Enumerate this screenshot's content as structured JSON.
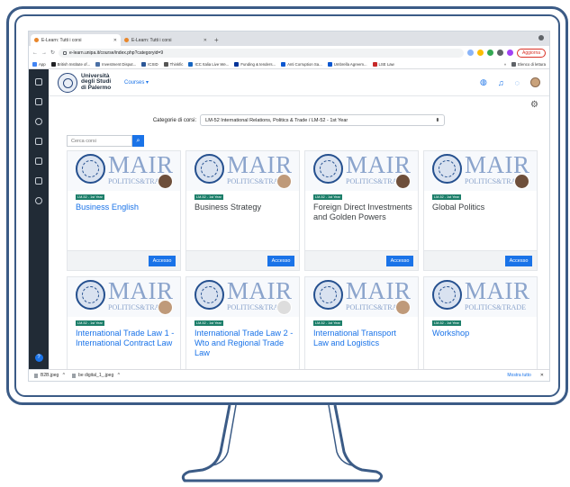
{
  "browser": {
    "tabs": [
      {
        "title": "E-Learn: Tutti i corsi",
        "active": true
      },
      {
        "title": "E-Learn: Tutti i corsi",
        "active": false
      }
    ],
    "url": "e-learn.unipa.it/course/index.php?categoryid=9",
    "update_label": "Aggiorna",
    "bookmarks": [
      "App",
      "British Institute of...",
      "Investment Disput...",
      "ICSID",
      "Thinkfic",
      "ICC Italia Live We...",
      "Funding & tenders...",
      "Anti Corruption Sa...",
      "Umbrella Agreem...",
      "LSE Law"
    ],
    "reading_list": "Elenco di lettura"
  },
  "site": {
    "logo_text": "Università degli Studi di Palermo",
    "courses_menu": "Courses"
  },
  "filter": {
    "category_label": "Categorie di corsi:",
    "category_value": "LM-52 International Relations, Politics & Trade / LM-52 - 1st Year",
    "search_placeholder": "Cerca corsi"
  },
  "course_image": {
    "brand": "MAIR",
    "subtitle": "POLITICS&TRADE",
    "subtitle_short": "POLITICS&TRA"
  },
  "courses": [
    {
      "badge": "LM-52 - 1st Year",
      "title": "Business English",
      "button": "Accesso"
    },
    {
      "badge": "LM-52 - 1st Year",
      "title": "Business Strategy",
      "button": "Accesso"
    },
    {
      "badge": "LM-52 - 1st Year",
      "title": "Foreign Direct Investments and Golden Powers",
      "button": "Accesso"
    },
    {
      "badge": "LM-52 - 1st Year",
      "title": "Global Politics",
      "button": "Accesso"
    },
    {
      "badge": "LM-52 - 1st Year",
      "title": "International Trade Law 1 - International Contract Law"
    },
    {
      "badge": "LM-52 - 1st Year",
      "title": "International Trade Law 2 - Wto and Regional Trade Law"
    },
    {
      "badge": "LM-52 - 1st Year",
      "title": "International Transport Law and Logistics"
    },
    {
      "badge": "LM-52 - 1st Year",
      "title": "Workshop"
    }
  ],
  "downloads": {
    "items": [
      "B2B.jpeg",
      "be digital_1_.jpeg"
    ],
    "show_all": "Mostra tutto"
  },
  "colors": {
    "accent": "#1a73e8",
    "sidebar": "#212b36",
    "badge": "#1d7f6a",
    "frame": "#3b5b86"
  }
}
